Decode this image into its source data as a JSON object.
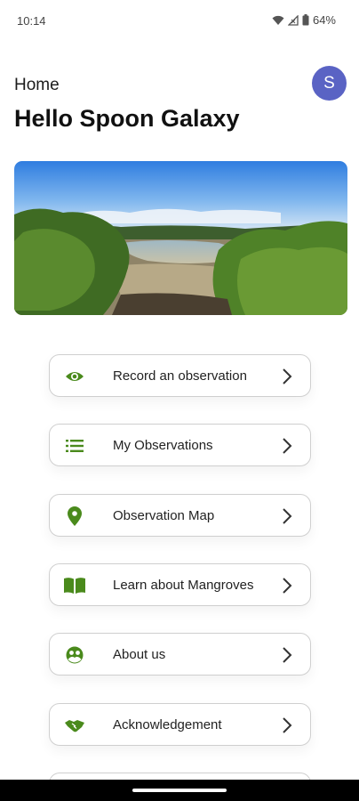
{
  "status_bar": {
    "time": "10:14",
    "battery": "64%"
  },
  "header": {
    "page_label": "Home",
    "greeting": "Hello Spoon Galaxy",
    "avatar_initial": "S",
    "avatar_color": "#5a63c4"
  },
  "accent_color": "#4a8a1c",
  "menu": {
    "items": [
      {
        "label": "Record an observation",
        "icon": "eye-icon"
      },
      {
        "label": "My Observations",
        "icon": "list-icon"
      },
      {
        "label": "Observation Map",
        "icon": "map-pin-icon"
      },
      {
        "label": "Learn about Mangroves",
        "icon": "book-icon"
      },
      {
        "label": "About us",
        "icon": "group-icon"
      },
      {
        "label": "Acknowledgement",
        "icon": "handshake-icon"
      }
    ]
  }
}
